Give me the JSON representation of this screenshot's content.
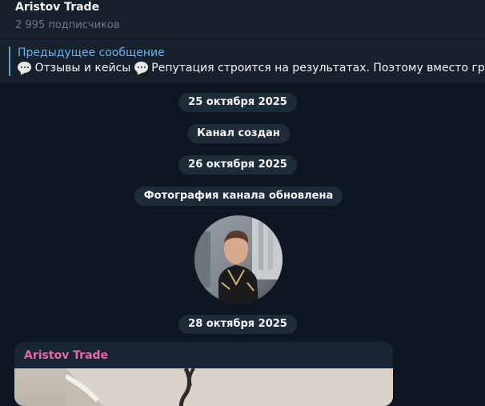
{
  "header": {
    "title": "Aristov Trade",
    "subtitle": "2 995 подписчиков"
  },
  "pinned": {
    "title": "Предыдущее сообщение",
    "part1": "Отзывы и кейсы",
    "part2": "Репутация строится на результатах. Поэтому вместо громких"
  },
  "service_messages": {
    "date1": "25 октября 2025",
    "created": "Канал создан",
    "date2": "26 октября 2025",
    "photo_updated": "Фотография канала обновлена",
    "date3": "28 октября 2025"
  },
  "post": {
    "author": "Aristov Trade"
  },
  "colors": {
    "background": "#0e1621",
    "panel": "#17212b",
    "accent": "#6ab2f2",
    "author": "#e56aa7"
  }
}
